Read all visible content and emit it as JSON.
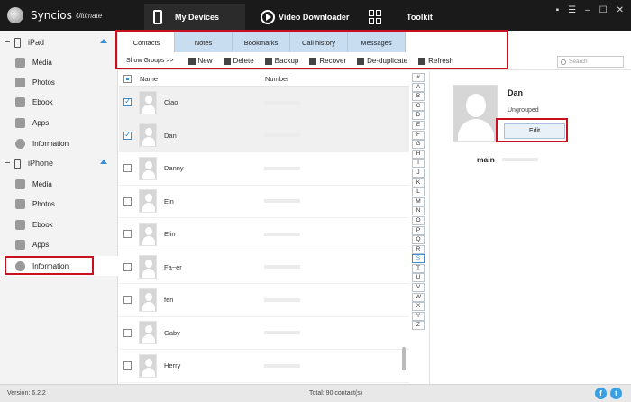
{
  "app": {
    "name": "Syncios",
    "edition": "Ultimate"
  },
  "top_tabs": [
    {
      "label": "My Devices",
      "icon": "phone-icon",
      "active": true
    },
    {
      "label": "Video Downloader",
      "icon": "play-icon",
      "active": false
    },
    {
      "label": "Toolkit",
      "icon": "toolkit-icon",
      "active": false
    }
  ],
  "window_controls": [
    "chat-icon",
    "menu-icon",
    "minimize-icon",
    "maximize-icon",
    "close-icon"
  ],
  "sidebar": {
    "devices": [
      {
        "name": "iPad",
        "items": [
          "Media",
          "Photos",
          "Ebook",
          "Apps",
          "Information"
        ]
      },
      {
        "name": "iPhone",
        "items": [
          "Media",
          "Photos",
          "Ebook",
          "Apps",
          "Information"
        ]
      }
    ],
    "active_item": "Information"
  },
  "content_tabs": [
    "Contacts",
    "Notes",
    "Bookmarks",
    "Call history",
    "Messages"
  ],
  "toolbar": {
    "show_groups": "Show Groups >>",
    "new": "New",
    "delete": "Delete",
    "backup": "Backup",
    "recover": "Recover",
    "dedup": "De-duplicate",
    "refresh": "Refresh",
    "search_placeholder": "Search"
  },
  "list": {
    "columns": [
      "Name",
      "Number"
    ],
    "rows": [
      {
        "name": "Ciao",
        "checked": true
      },
      {
        "name": "Dan",
        "checked": true
      },
      {
        "name": "Danny",
        "checked": false
      },
      {
        "name": "Ein",
        "checked": false
      },
      {
        "name": "Elin",
        "checked": false
      },
      {
        "name": "Fa~er",
        "checked": false
      },
      {
        "name": "fen",
        "checked": false
      },
      {
        "name": "Gaby",
        "checked": false
      },
      {
        "name": "Herry",
        "checked": false
      }
    ]
  },
  "alpha_index": [
    "#",
    "A",
    "B",
    "C",
    "D",
    "E",
    "F",
    "G",
    "H",
    "I",
    "J",
    "K",
    "L",
    "M",
    "N",
    "O",
    "P",
    "Q",
    "R",
    "S",
    "T",
    "U",
    "V",
    "W",
    "X",
    "Y",
    "Z"
  ],
  "alpha_current": "S",
  "detail": {
    "name": "Dan",
    "group": "Ungrouped",
    "edit": "Edit",
    "phone_label": "main"
  },
  "status": {
    "version": "Version: 6.2.2",
    "total": "Total: 90 contact(s)"
  },
  "colors": {
    "accent": "#3a8fd4",
    "highlight": "#c8101e",
    "tab_bg": "#c9ddf1"
  }
}
